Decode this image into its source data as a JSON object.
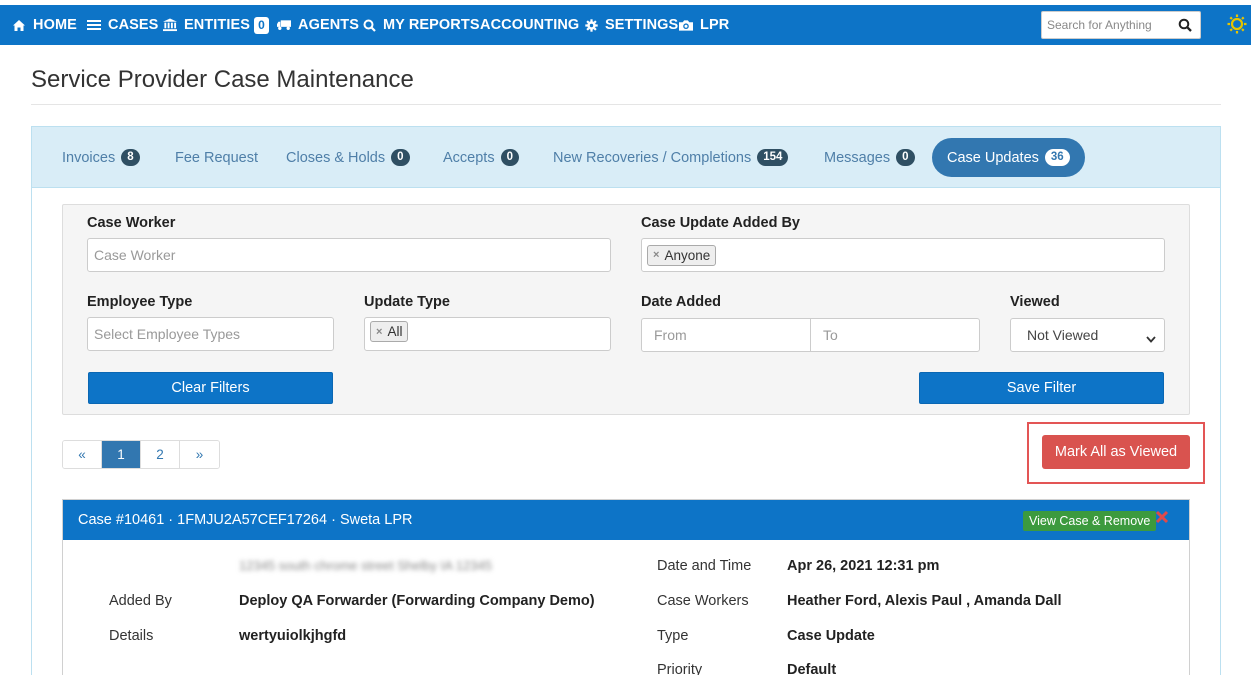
{
  "nav": {
    "items": [
      {
        "label": "HOME",
        "icon": "home-icon"
      },
      {
        "label": "CASES",
        "icon": "menu-icon"
      },
      {
        "label": "ENTITIES",
        "icon": "bank-icon",
        "badge": "0"
      },
      {
        "label": "AGENTS",
        "icon": "truck-icon"
      },
      {
        "label": "MY REPORTS",
        "icon": "search-icon"
      },
      {
        "label": "ACCOUNTING"
      },
      {
        "label": "SETTINGS",
        "icon": "gear-icon"
      },
      {
        "label": "LPR",
        "icon": "camera-icon"
      }
    ],
    "search_placeholder": "Search for Anything",
    "accent": "#0d74c7"
  },
  "page": {
    "title": "Service Provider Case Maintenance"
  },
  "tabs": [
    {
      "label": "Invoices",
      "count": "8"
    },
    {
      "label": "Fee Request"
    },
    {
      "label": "Closes & Holds",
      "count": "0"
    },
    {
      "label": "Accepts",
      "count": "0"
    },
    {
      "label": "New Recoveries / Completions",
      "count": "154"
    },
    {
      "label": "Messages",
      "count": "0"
    },
    {
      "label": "Case Updates",
      "count": "36",
      "active": true
    }
  ],
  "filters": {
    "case_worker_label": "Case Worker",
    "case_worker_placeholder": "Case Worker",
    "added_by_label": "Case Update Added By",
    "added_by_value": "Anyone",
    "employee_type_label": "Employee Type",
    "employee_type_placeholder": "Select Employee Types",
    "update_type_label": "Update Type",
    "update_type_value": "All",
    "date_added_label": "Date Added",
    "date_from_placeholder": "From",
    "date_to_placeholder": "To",
    "viewed_label": "Viewed",
    "viewed_value": "Not Viewed",
    "clear_label": "Clear Filters",
    "save_label": "Save Filter"
  },
  "pagination": {
    "prev": "«",
    "pages": [
      "1",
      "2"
    ],
    "next": "»",
    "current": "1"
  },
  "mark_all_label": "Mark All as Viewed",
  "case": {
    "header": "Case #10461 · 1FMJU2A57CEF17264 · Sweta LPR",
    "view_remove_label": "View Case & Remove",
    "blurred_address": "12345 south chrome street Shelby IA 12345",
    "added_by_label": "Added By",
    "added_by_value": "Deploy QA Forwarder (Forwarding Company Demo)",
    "details_label": "Details",
    "details_value": "wertyuiolkjhgfd",
    "datetime_label": "Date and Time",
    "datetime_value": "Apr 26, 2021 12:31 pm",
    "workers_label": "Case Workers",
    "workers_value": "Heather Ford, Alexis Paul , Amanda Dall",
    "type_label": "Type",
    "type_value": "Case Update",
    "priority_label": "Priority",
    "priority_value": "Default"
  }
}
